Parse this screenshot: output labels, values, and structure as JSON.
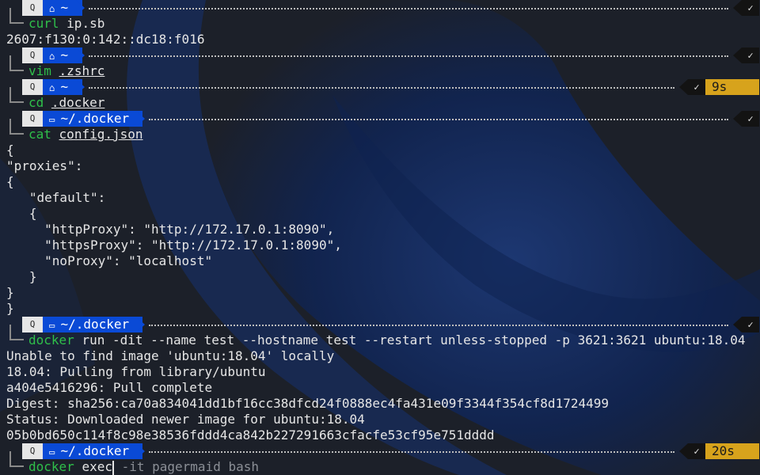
{
  "prompt_icons": {
    "os": "penguin-icon",
    "home": "home-icon",
    "folder": "folder-icon"
  },
  "colors": {
    "dir_bg": "#0a4ad6",
    "cmd_green": "#2fbf4a",
    "timer_bg": "#d7a31c"
  },
  "status_ok": "✓",
  "blocks": [
    {
      "dir": "~",
      "command": "curl",
      "args": "ip.sb",
      "args_underline": false,
      "duration": "",
      "output": [
        "2607:f130:0:142::dc18:f016"
      ]
    },
    {
      "dir": "~",
      "command": "vim",
      "args": ".zshrc",
      "args_underline": true,
      "duration": "",
      "output": []
    },
    {
      "dir": "~",
      "command": "cd",
      "args": ".docker",
      "args_underline": true,
      "duration": "9s",
      "output": []
    },
    {
      "dir": "~/.docker",
      "command": "cat",
      "args": "config.json",
      "args_underline": true,
      "duration": "",
      "output": [
        "{",
        "\"proxies\":",
        "{",
        "   \"default\":",
        "   {",
        "     \"httpProxy\": \"http://172.17.0.1:8090\",",
        "     \"httpsProxy\": \"http://172.17.0.1:8090\",",
        "     \"noProxy\": \"localhost\"",
        "   }",
        "}",
        "}"
      ]
    },
    {
      "dir": "~/.docker",
      "command": "docker",
      "args": "run -dit --name test --hostname test --restart unless-stopped -p 3621:3621 ubuntu:18.04",
      "args_underline": false,
      "duration": "",
      "output": [
        "Unable to find image 'ubuntu:18.04' locally",
        "18.04: Pulling from library/ubuntu",
        "a404e5416296: Pull complete",
        "Digest: sha256:ca70a834041dd1bf16cc38dfcd24f0888ec4fa431e09f3344f354cf8d1724499",
        "Status: Downloaded newer image for ubuntu:18.04",
        "05b0bd650c114f8c98e38536fddd4ca842b227291663cfacfe53cf95e751dddd"
      ]
    }
  ],
  "current": {
    "dir": "~/.docker",
    "duration": "20s",
    "command": "docker",
    "typed": "exec",
    "suggestion": " -it pagermaid bash"
  }
}
